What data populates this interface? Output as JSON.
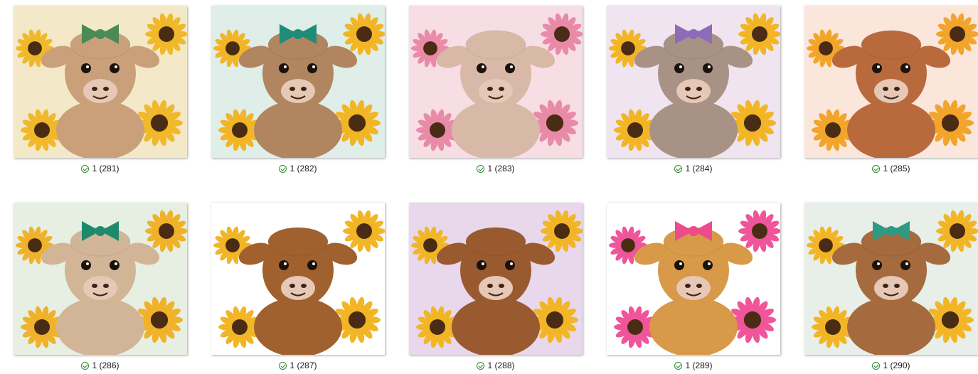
{
  "files": [
    {
      "name": "1 (281)",
      "status_icon": "sync-ok-icon",
      "bg": "#f3e9c8",
      "accent": "#f0b82a",
      "fur": "#c9a07a",
      "bow": "#4a8a56"
    },
    {
      "name": "1 (282)",
      "status_icon": "sync-ok-icon",
      "bg": "#dfeee8",
      "accent": "#f2b526",
      "fur": "#b08560",
      "bow": "#1f8c7a"
    },
    {
      "name": "1 (283)",
      "status_icon": "sync-ok-icon",
      "bg": "#f7dde4",
      "accent": "#e98aa9",
      "fur": "#d8b9a8",
      "bow": ""
    },
    {
      "name": "1 (284)",
      "status_icon": "sync-ok-icon",
      "bg": "#efe4ef",
      "accent": "#f2b526",
      "fur": "#a89286",
      "bow": "#8e6bb8"
    },
    {
      "name": "1 (285)",
      "status_icon": "sync-ok-icon",
      "bg": "#fbe6dc",
      "accent": "#f2a52a",
      "fur": "#b86a3c",
      "bow": ""
    },
    {
      "name": "1 (286)",
      "status_icon": "sync-ok-icon",
      "bg": "#e6efe2",
      "accent": "#f0b22a",
      "fur": "#d2b597",
      "bow": "#1e8a6c"
    },
    {
      "name": "1 (287)",
      "status_icon": "sync-ok-icon",
      "bg": "#ffffff",
      "accent": "#f2b526",
      "fur": "#a0612e",
      "bow": ""
    },
    {
      "name": "1 (288)",
      "status_icon": "sync-ok-icon",
      "bg": "#e9d7ec",
      "accent": "#f2b526",
      "fur": "#9a5a30",
      "bow": ""
    },
    {
      "name": "1 (289)",
      "status_icon": "sync-ok-icon",
      "bg": "#ffffff",
      "accent": "#f0559a",
      "fur": "#d89a48",
      "bow": "#ec4c8c"
    },
    {
      "name": "1 (290)",
      "status_icon": "sync-ok-icon",
      "bg": "#e7efe8",
      "accent": "#f2b526",
      "fur": "#a56a3e",
      "bow": "#2e9a84"
    }
  ]
}
